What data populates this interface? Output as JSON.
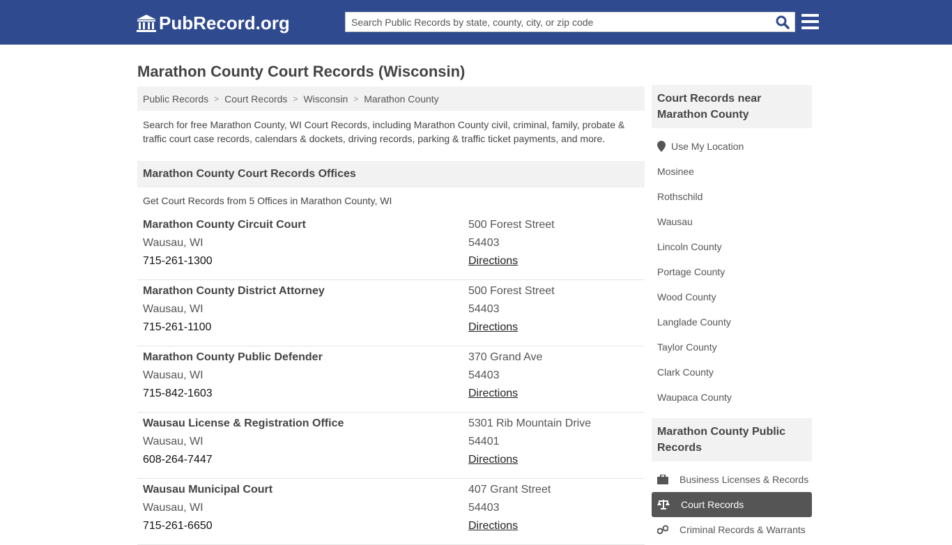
{
  "header": {
    "logo_text": "PubRecord.org",
    "search_placeholder": "Search Public Records by state, county, city, or zip code"
  },
  "page_title": "Marathon County Court Records (Wisconsin)",
  "breadcrumb": [
    "Public Records",
    "Court Records",
    "Wisconsin",
    "Marathon County"
  ],
  "intro": "Search for free Marathon County, WI Court Records, including Marathon County civil, criminal, family, probate & traffic court case records, calendars & dockets, driving records, parking & traffic ticket payments, and more.",
  "offices_section": {
    "title": "Marathon County Court Records Offices",
    "subtitle": "Get Court Records from 5 Offices in Marathon County, WI",
    "offices": [
      {
        "name": "Marathon County Circuit Court",
        "city": "Wausau, WI",
        "phone": "715-261-1300",
        "address": "500 Forest Street",
        "zip": "54403",
        "directions": "Directions"
      },
      {
        "name": "Marathon County District Attorney",
        "city": "Wausau, WI",
        "phone": "715-261-1100",
        "address": "500 Forest Street",
        "zip": "54403",
        "directions": "Directions"
      },
      {
        "name": "Marathon County Public Defender",
        "city": "Wausau, WI",
        "phone": "715-842-1603",
        "address": "370 Grand Ave",
        "zip": "54403",
        "directions": "Directions"
      },
      {
        "name": "Wausau License & Registration Office",
        "city": "Wausau, WI",
        "phone": "608-264-7447",
        "address": "5301 Rib Mountain Drive",
        "zip": "54401",
        "directions": "Directions"
      },
      {
        "name": "Wausau Municipal Court",
        "city": "Wausau, WI",
        "phone": "715-261-6650",
        "address": "407 Grant Street",
        "zip": "54403",
        "directions": "Directions"
      }
    ]
  },
  "sidebar": {
    "nearby_title": "Court Records near Marathon County",
    "use_location": "Use My Location",
    "nearby": [
      "Mosinee",
      "Rothschild",
      "Wausau",
      "Lincoln County",
      "Portage County",
      "Wood County",
      "Langlade County",
      "Taylor County",
      "Clark County",
      "Waupaca County"
    ],
    "public_records_title": "Marathon County Public Records",
    "public_records": [
      {
        "label": "Business Licenses & Records",
        "icon": "briefcase-icon",
        "active": false
      },
      {
        "label": "Court Records",
        "icon": "scale-icon",
        "active": true
      },
      {
        "label": "Criminal Records & Warrants",
        "icon": "handcuffs-icon",
        "active": false
      }
    ]
  }
}
